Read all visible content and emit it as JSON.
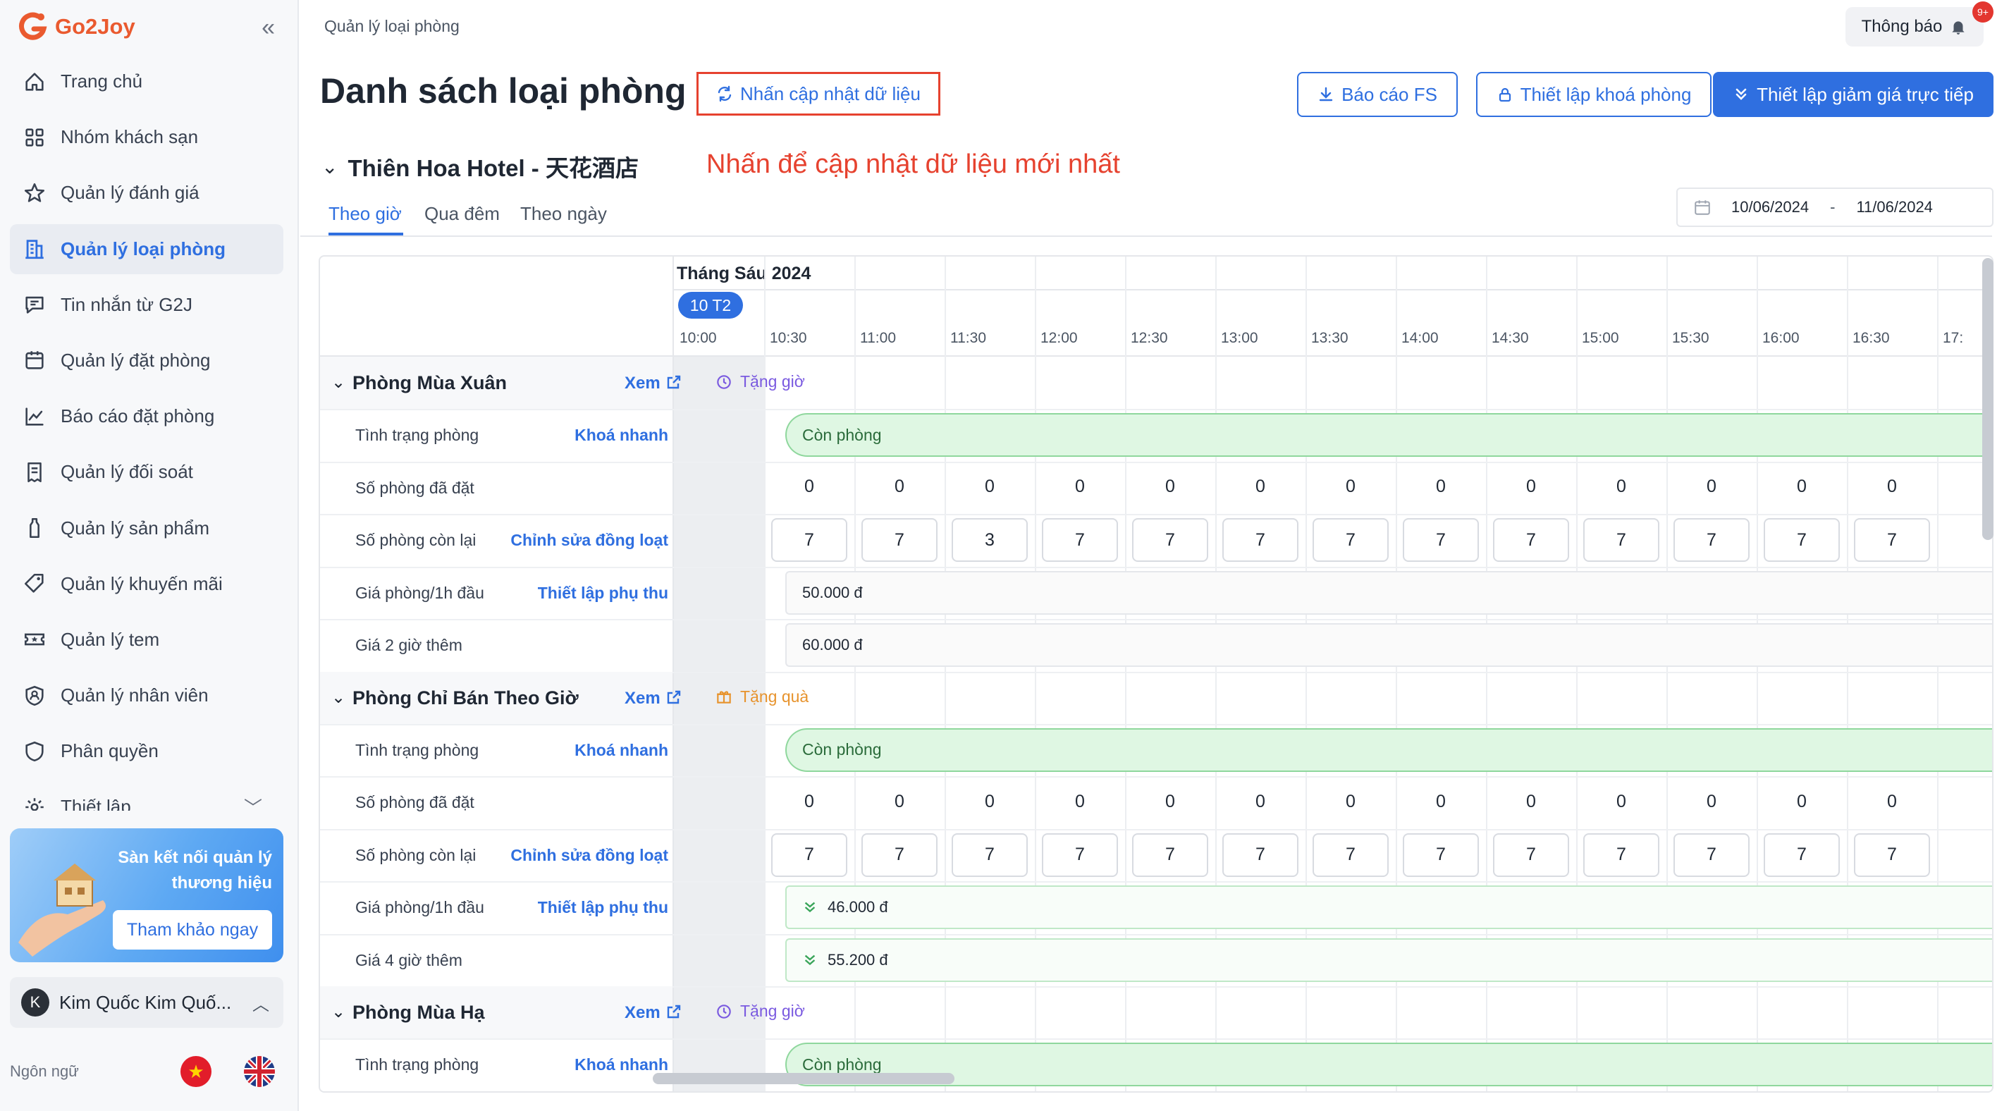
{
  "app": {
    "name": "Go2Joy"
  },
  "sidebar": {
    "items": [
      {
        "label": "Trang chủ",
        "icon": "home-icon"
      },
      {
        "label": "Nhóm khách sạn",
        "icon": "grid-icon"
      },
      {
        "label": "Quản lý đánh giá",
        "icon": "star-icon"
      },
      {
        "label": "Quản lý loại phòng",
        "icon": "building-icon",
        "active": true
      },
      {
        "label": "Tin nhắn từ G2J",
        "icon": "message-icon"
      },
      {
        "label": "Quản lý đặt phòng",
        "icon": "calendar-icon"
      },
      {
        "label": "Báo cáo đặt phòng",
        "icon": "chart-icon"
      },
      {
        "label": "Quản lý đối soát",
        "icon": "receipt-icon"
      },
      {
        "label": "Quản lý sản phẩm",
        "icon": "bottle-icon"
      },
      {
        "label": "Quản lý khuyến mãi",
        "icon": "tag-icon"
      },
      {
        "label": "Quản lý tem",
        "icon": "ticket-icon"
      },
      {
        "label": "Quản lý nhân viên",
        "icon": "user-badge-icon"
      },
      {
        "label": "Phân quyền",
        "icon": "shield-icon"
      },
      {
        "label": "Thiết lập",
        "icon": "settings-icon"
      }
    ],
    "promo": {
      "text": "Sàn kết nối quản lý thương hiệu",
      "button": "Tham khảo ngay"
    },
    "user": {
      "initial": "K",
      "name": "Kim Quốc Kim Quố..."
    },
    "language": {
      "label": "Ngôn ngữ"
    }
  },
  "header": {
    "breadcrumb": "Quản lý loại phòng",
    "notifications": {
      "label": "Thông báo",
      "badge": "9+"
    }
  },
  "page": {
    "title": "Danh sách loại phòng",
    "refresh_label": "Nhấn cập nhật dữ liệu",
    "annotation": "Nhấn để cập nhật dữ liệu mới nhất",
    "buttons": {
      "report": "Báo cáo FS",
      "lock_setup": "Thiết lập khoá phòng",
      "discount_setup": "Thiết lập giảm giá trực tiếp"
    },
    "hotel_name": "Thiên Hoa Hotel - 天花酒店",
    "tabs": [
      "Theo giờ",
      "Qua đêm",
      "Theo ngày"
    ],
    "date_range": {
      "from": "10/06/2024",
      "to": "11/06/2024",
      "separator": "-"
    }
  },
  "schedule": {
    "month": "Tháng Sáu 2024",
    "day": "10 T2",
    "times": [
      "10:00",
      "10:30",
      "11:00",
      "11:30",
      "12:00",
      "12:30",
      "13:00",
      "13:30",
      "14:00",
      "14:30",
      "15:00",
      "15:30",
      "16:00",
      "16:30",
      "17:"
    ],
    "rooms": [
      {
        "name": "Phòng Mùa Xuân",
        "view": "Xem",
        "perk": "Tặng giờ",
        "rows": [
          {
            "label": "Tình trạng phòng",
            "action": "Khoá nhanh",
            "status": "Còn phòng"
          },
          {
            "label": "Số phòng đã đặt",
            "values": [
              "0",
              "0",
              "0",
              "0",
              "0",
              "0",
              "0",
              "0",
              "0",
              "0",
              "0",
              "0",
              "0"
            ]
          },
          {
            "label": "Số phòng còn lại",
            "action": "Chỉnh sửa đồng loạt",
            "values": [
              "7",
              "7",
              "3",
              "7",
              "7",
              "7",
              "7",
              "7",
              "7",
              "7",
              "7",
              "7",
              "7"
            ]
          },
          {
            "label": "Giá phòng/1h đầu",
            "action": "Thiết lập phụ thu",
            "price": "50.000 đ"
          },
          {
            "label": "Giá 2 giờ thêm",
            "price": "60.000 đ"
          }
        ]
      },
      {
        "name": "Phòng Chỉ Bán Theo Giờ",
        "view": "Xem",
        "perk": "Tặng quà",
        "rows": [
          {
            "label": "Tình trạng phòng",
            "action": "Khoá nhanh",
            "status": "Còn phòng"
          },
          {
            "label": "Số phòng đã đặt",
            "values": [
              "0",
              "0",
              "0",
              "0",
              "0",
              "0",
              "0",
              "0",
              "0",
              "0",
              "0",
              "0",
              "0"
            ]
          },
          {
            "label": "Số phòng còn lại",
            "action": "Chỉnh sửa đồng loạt",
            "values": [
              "7",
              "7",
              "7",
              "7",
              "7",
              "7",
              "7",
              "7",
              "7",
              "7",
              "7",
              "7",
              "7"
            ]
          },
          {
            "label": "Giá phòng/1h đầu",
            "action": "Thiết lập phụ thu",
            "price": "46.000 đ"
          },
          {
            "label": "Giá 4 giờ thêm",
            "price": "55.200 đ"
          }
        ]
      },
      {
        "name": "Phòng Mùa Hạ",
        "view": "Xem",
        "perk": "Tặng giờ",
        "rows": [
          {
            "label": "Tình trạng phòng",
            "action": "Khoá nhanh",
            "status": "Còn phòng"
          }
        ]
      }
    ]
  },
  "colors": {
    "primary": "#2f6fe0",
    "brand": "#ea5a2f",
    "annotation": "#e6422f",
    "available": "#dff7e3"
  }
}
